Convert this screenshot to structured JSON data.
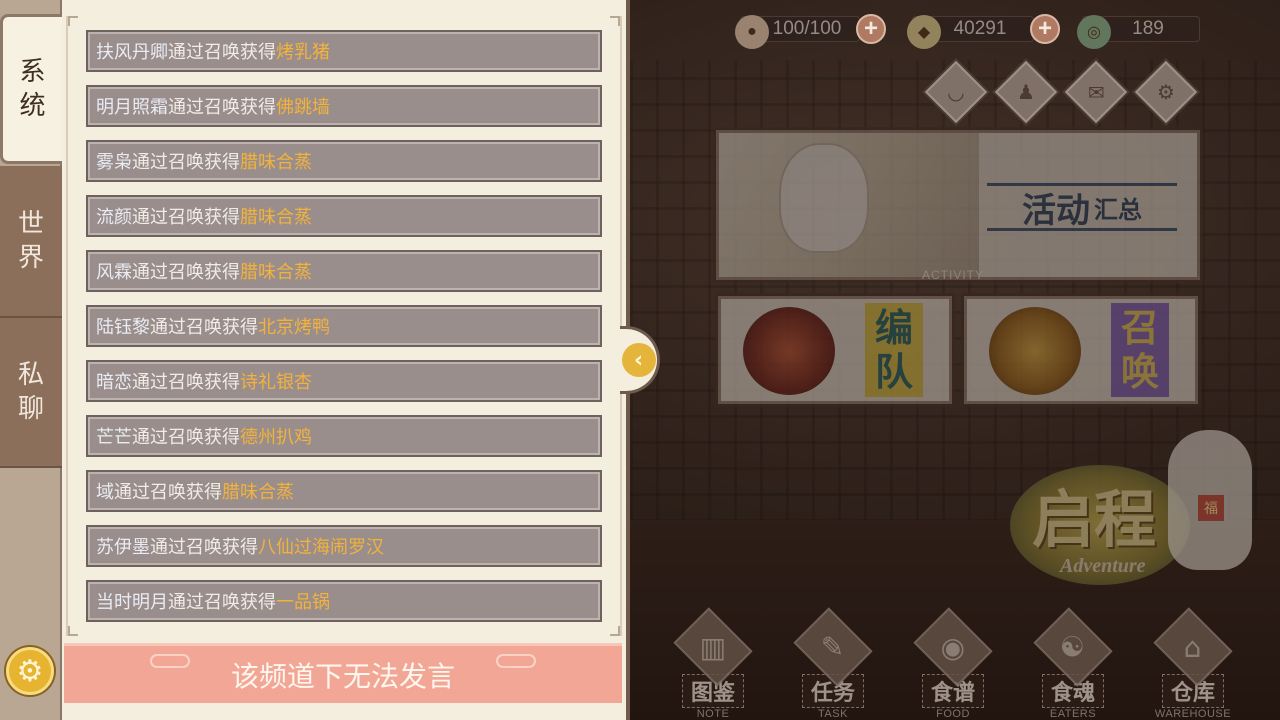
{
  "resources": [
    {
      "icon": "dumpling-icon",
      "value": "100/100"
    },
    {
      "icon": "leaf-coin-icon",
      "value": "40291"
    },
    {
      "icon": "jade-coin-icon",
      "value": "189"
    }
  ],
  "top_icons": [
    "bowl-icon",
    "bag-icon",
    "mail-icon",
    "gear-icon"
  ],
  "activity": {
    "title_big": "活动",
    "title_small": "汇总",
    "label": "ACTIVITY"
  },
  "cards": [
    {
      "label_top": "编",
      "label_bottom": "队"
    },
    {
      "label_top": "召",
      "label_bottom": "唤"
    }
  ],
  "adventure": {
    "title": "启程",
    "subtitle": "Adventure",
    "cat_tag": "福"
  },
  "bottom_nav": [
    {
      "label": "图鉴",
      "sub": "NOTE",
      "icon": "book-icon"
    },
    {
      "label": "任务",
      "sub": "TASK",
      "icon": "scroll-icon"
    },
    {
      "label": "食谱",
      "sub": "FOOD",
      "icon": "plate-icon"
    },
    {
      "label": "食魂",
      "sub": "EATERS",
      "icon": "spirit-icon"
    },
    {
      "label": "仓库",
      "sub": "WAREHOUSE",
      "icon": "storehouse-icon"
    }
  ],
  "chat": {
    "tabs": [
      {
        "top": "系",
        "bottom": "统",
        "active": true
      },
      {
        "top": "世",
        "bottom": "界",
        "active": false
      },
      {
        "top": "私",
        "bottom": "聊",
        "active": false
      }
    ],
    "messages": [
      {
        "name": "扶风丹卿",
        "verb": "通过召唤获得",
        "item": "烤乳猪"
      },
      {
        "name": "明月照霜",
        "verb": "通过召唤获得",
        "item": "佛跳墙"
      },
      {
        "name": "雾枭",
        "verb": "通过召唤获得",
        "item": "腊味合蒸"
      },
      {
        "name": "流颜",
        "verb": "通过召唤获得",
        "item": "腊味合蒸"
      },
      {
        "name": "风霖",
        "verb": "通过召唤获得",
        "item": "腊味合蒸"
      },
      {
        "name": "陆钰黎",
        "verb": "通过召唤获得",
        "item": "北京烤鸭"
      },
      {
        "name": "暗恋",
        "verb": "通过召唤获得",
        "item": "诗礼银杏"
      },
      {
        "name": "芒芒",
        "verb": "通过召唤获得",
        "item": "德州扒鸡"
      },
      {
        "name": "域",
        "verb": "通过召唤获得",
        "item": "腊味合蒸"
      },
      {
        "name": "苏伊墨",
        "verb": "通过召唤获得",
        "item": "八仙过海闹罗汉"
      },
      {
        "name": "当时明月",
        "verb": "通过召唤获得",
        "item": "一品锅"
      }
    ],
    "footer_text": "该频道下无法发言"
  },
  "colors": {
    "name": "#e9ecf4",
    "item": "#f3b23a",
    "footer_bg": "#f2a796",
    "row_bg": "#9a8e8c"
  }
}
